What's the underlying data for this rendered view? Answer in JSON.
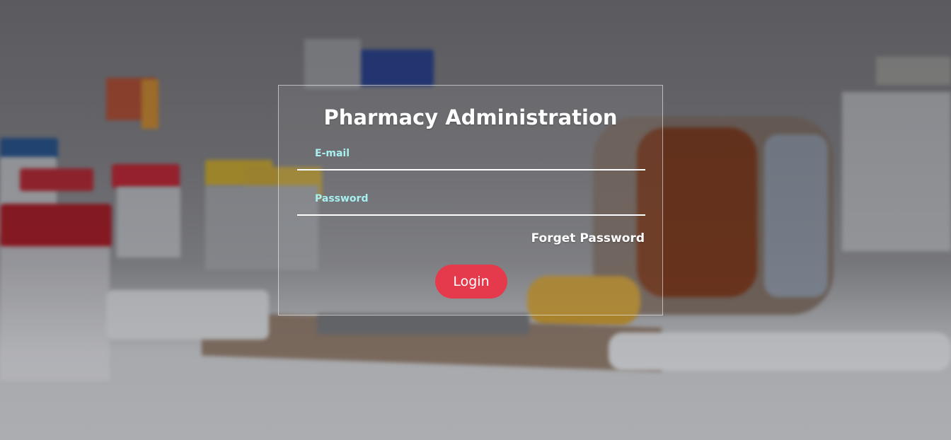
{
  "login": {
    "title": "Pharmacy Administration",
    "email_label": "E-mail",
    "email_value": "",
    "password_label": "Password",
    "password_value": "",
    "forget_link": "Forget Password",
    "login_button": "Login"
  },
  "colors": {
    "accent_button": "#e53a4c",
    "label_text": "#a8f0ef",
    "title_text": "#ffffff"
  },
  "background": {
    "description_icon": "pharmacy-background-photo"
  }
}
